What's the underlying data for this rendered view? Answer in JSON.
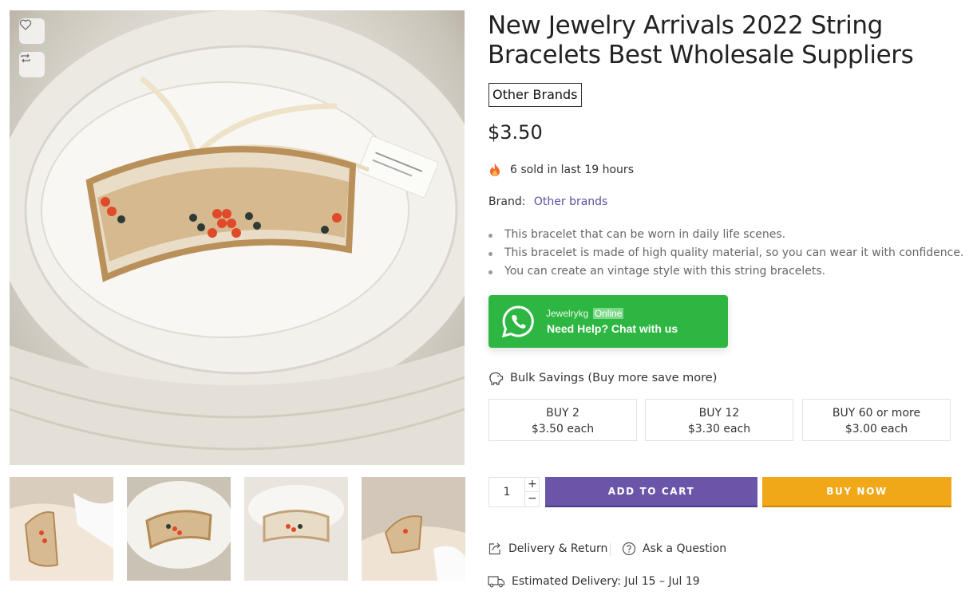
{
  "product": {
    "title": "New Jewelry Arrivals 2022 String Bracelets Best Wholesale Suppliers",
    "brand_badge": "Other Brands",
    "price": "$3.50",
    "sold_text": "6 sold in last 19 hours",
    "brand_label": "Brand:",
    "brand_link": "Other brands",
    "features": [
      "This bracelet that can be worn in daily life scenes.",
      "This bracelet is made of high quality material, so you can wear it with confidence.",
      "You can create an vintage style with this string bracelets."
    ]
  },
  "gallery": {
    "wishlist_icon": "heart-icon",
    "compare_icon": "compare-arrows-icon",
    "thumbnails": [
      "thumbnail-worn-wrist",
      "thumbnail-on-plate",
      "thumbnail-flat",
      "thumbnail-worn-side"
    ]
  },
  "whatsapp": {
    "name": "Jewelrykg",
    "status": "Online",
    "cta": "Need Help? Chat with us",
    "color": "#2db742"
  },
  "bulk": {
    "title": "Bulk Savings (Buy more save more)",
    "tiers": [
      {
        "qty": "BUY 2",
        "price": "$3.50 each"
      },
      {
        "qty": "BUY 12",
        "price": "$3.30 each"
      },
      {
        "qty": "BUY 60 or more",
        "price": "$3.00 each"
      }
    ]
  },
  "purchase": {
    "quantity": "1",
    "plus": "+",
    "minus": "−",
    "add_to_cart": "ADD TO CART",
    "buy_now": "BUY NOW",
    "add_to_cart_color": "#6a55a8",
    "buy_now_color": "#f0a818"
  },
  "links": {
    "delivery_return": "Delivery & Return",
    "ask_question": "Ask a Question",
    "estimated_delivery": "Estimated Delivery: Jul 15 – Jul 19"
  }
}
